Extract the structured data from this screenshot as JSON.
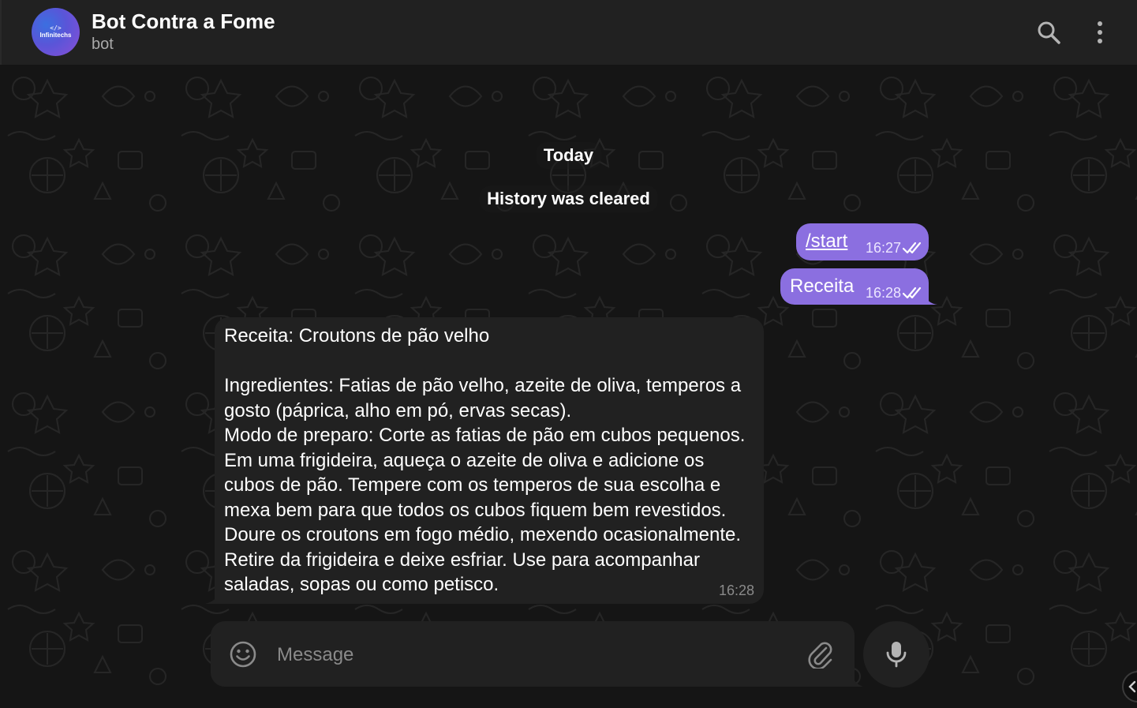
{
  "header": {
    "avatar_code": "</>",
    "avatar_brand": "Infinitechs",
    "title": "Bot Contra a Fome",
    "subtitle": "bot",
    "icons": [
      "search-icon",
      "more-vertical-icon"
    ]
  },
  "chat": {
    "date_label": "Today",
    "service_message": "History was cleared",
    "messages": [
      {
        "direction": "out",
        "text": "/start",
        "time": "16:27",
        "status": "read"
      },
      {
        "direction": "out",
        "text": "Receita",
        "time": "16:28",
        "status": "read"
      },
      {
        "direction": "in",
        "text": "Receita: Croutons de pão velho\n\nIngredientes: Fatias de pão velho, azeite de oliva, temperos a gosto (páprica, alho em pó, ervas secas).\nModo de preparo: Corte as fatias de pão em cubos pequenos. Em uma frigideira, aqueça o azeite de oliva e adicione os cubos de pão. Tempere com os temperos de sua escolha e mexa bem para que todos os cubos fiquem bem revestidos. Doure os croutons em fogo médio, mexendo ocasionalmente. Retire da frigideira e deixe esfriar. Use para acompanhar saladas, sopas ou como petisco.",
        "time": "16:28"
      }
    ]
  },
  "composer": {
    "placeholder": "Message",
    "icons": [
      "emoji-icon",
      "attach-icon",
      "microphone-icon"
    ]
  },
  "colors": {
    "outgoing_bubble": "#8b6fe0",
    "incoming_bubble": "#212121",
    "header_bg": "#212121",
    "chat_bg": "#151515"
  }
}
